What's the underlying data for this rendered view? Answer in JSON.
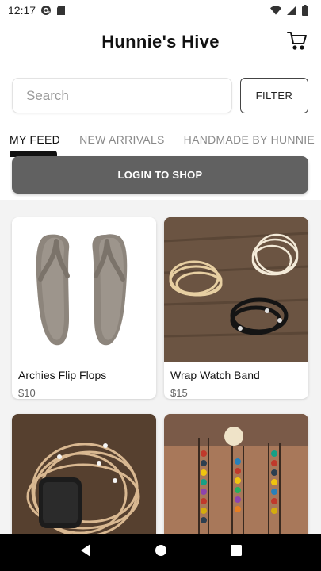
{
  "status_bar": {
    "time": "12:17",
    "icons": [
      "at-sign-icon",
      "sd-card-icon",
      "wifi-icon",
      "signal-icon",
      "battery-icon"
    ]
  },
  "app": {
    "title": "Hunnie's Hive",
    "cart_icon": "cart-icon"
  },
  "search": {
    "placeholder": "Search",
    "value": ""
  },
  "filter": {
    "label": "FILTER"
  },
  "tabs": [
    {
      "label": "MY FEED",
      "active": true
    },
    {
      "label": "NEW ARRIVALS",
      "active": false
    },
    {
      "label": "HANDMADE BY HUNNIE",
      "active": false
    }
  ],
  "login": {
    "label": "LOGIN TO SHOP"
  },
  "products": [
    {
      "name": "Archies Flip Flops",
      "price": "$10"
    },
    {
      "name": "Wrap Watch Band",
      "price": "$15"
    },
    {
      "name": "",
      "price": ""
    },
    {
      "name": "",
      "price": ""
    }
  ],
  "nav": {
    "icons": [
      "back-icon",
      "home-icon",
      "recents-icon"
    ]
  },
  "colors": {
    "login_bg": "#616161",
    "feed_bg": "#f3f3f3",
    "nav_bg": "#000000"
  }
}
